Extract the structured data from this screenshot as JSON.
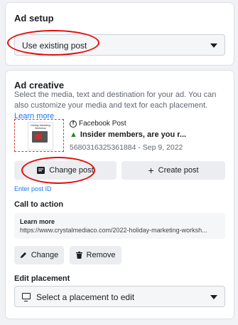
{
  "ad_setup": {
    "title": "Ad setup",
    "select_value": "Use existing post"
  },
  "ad_creative": {
    "title": "Ad creative",
    "description": "Select the media, text and destination for your ad. You can also customize your media and text for each placement.",
    "learn_more": "Learn more",
    "thumbnail_text": "Holiday Marketing Workshop",
    "post": {
      "source": "Facebook Post",
      "title": "Insider members, are you r...",
      "id_date": "5680316325361884 - Sep 9, 2022"
    },
    "buttons": {
      "change_post": "Change post",
      "create_post": "Create post",
      "enter_post_id": "Enter post ID"
    },
    "call_to_action": {
      "title": "Call to action",
      "label": "Learn more",
      "url": "https://www.crystalmediaco.com/2022-holiday-marketing-worksh...",
      "change": "Change",
      "remove": "Remove"
    },
    "edit_placement": {
      "title": "Edit placement",
      "select_value": "Select a placement to edit"
    }
  },
  "colors": {
    "link": "#1877f2",
    "annotation": "#e20a0a"
  },
  "icons": [
    "caret-down-icon",
    "facebook-icon",
    "tree-icon",
    "post-icon",
    "plus-icon",
    "pencil-icon",
    "trash-icon",
    "monitor-icon"
  ]
}
